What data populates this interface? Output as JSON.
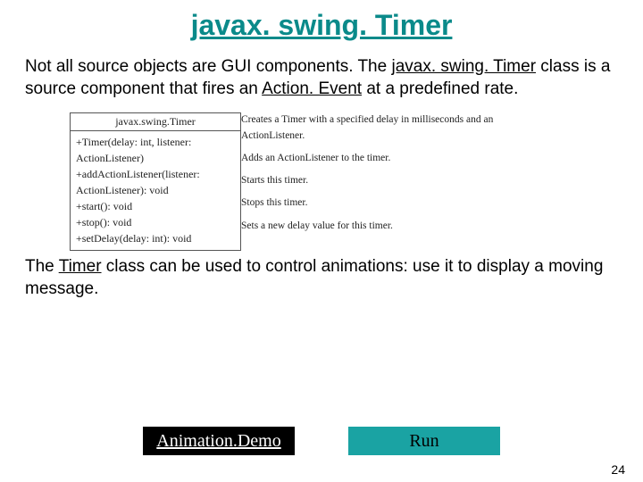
{
  "title": "javax. swing. Timer",
  "para1_pre": "Not all source objects are GUI components. The ",
  "para1_u1": "javax. swing. Timer",
  "para1_mid": " class is a source component that fires an ",
  "para1_u2": "Action. Event",
  "para1_post": " at a predefined rate.",
  "uml": {
    "header": "javax.swing.Timer",
    "rows": [
      "+Timer(delay: int, listener: ActionListener)",
      "+addActionListener(listener: ActionListener): void",
      "+start(): void",
      "+stop(): void",
      "+setDelay(delay: int): void"
    ],
    "descs": [
      "Creates a Timer with a specified delay in milliseconds and an ActionListener.",
      "Adds an ActionListener to the timer.",
      "Starts this timer.",
      "Stops this timer.",
      "Sets a new delay value for this timer."
    ]
  },
  "para2_pre": "The ",
  "para2_u": "Timer",
  "para2_post": " class can be used to control animations: use it to display a moving message.",
  "buttons": {
    "demo": "Animation.Demo",
    "run": "Run"
  },
  "page": "24"
}
